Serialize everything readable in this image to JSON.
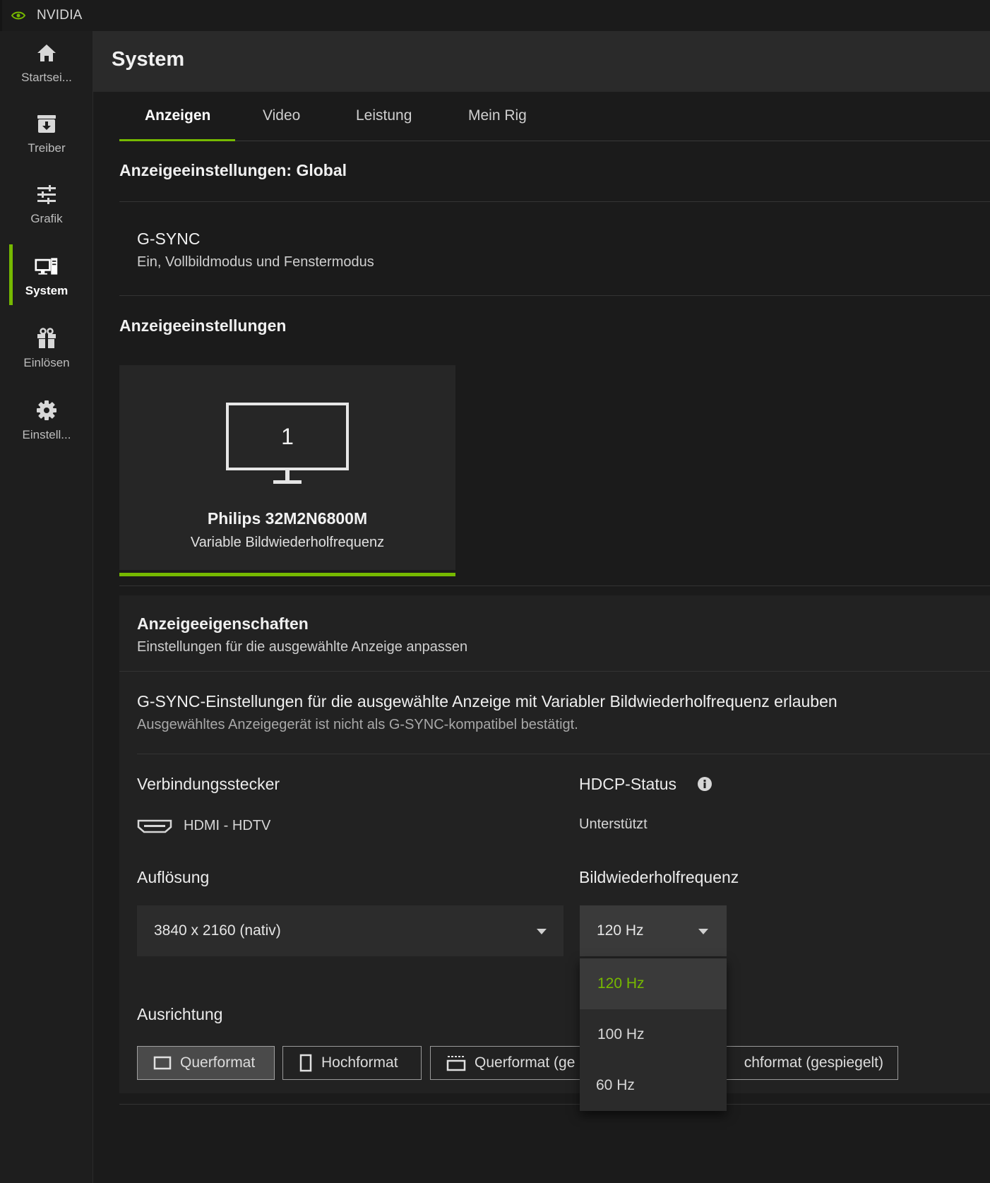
{
  "app": {
    "title": "NVIDIA",
    "accent": "#76b900"
  },
  "sidebar": {
    "items": [
      {
        "label": "Startsei...",
        "icon": "home-icon"
      },
      {
        "label": "Treiber",
        "icon": "driver-download-icon"
      },
      {
        "label": "Grafik",
        "icon": "sliders-icon"
      },
      {
        "label": "System",
        "icon": "system-monitor-icon",
        "active": true
      },
      {
        "label": "Einlösen",
        "icon": "gift-icon"
      },
      {
        "label": "Einstell...",
        "icon": "gear-icon"
      }
    ]
  },
  "header": {
    "title": "System"
  },
  "tabs": [
    {
      "label": "Anzeigen",
      "active": true
    },
    {
      "label": "Video"
    },
    {
      "label": "Leistung"
    },
    {
      "label": "Mein Rig"
    }
  ],
  "global": {
    "heading": "Anzeigeeinstellungen: Global",
    "gsync_title": "G-SYNC",
    "gsync_value": "Ein, Vollbildmodus und Fenstermodus"
  },
  "displays": {
    "heading": "Anzeigeeinstellungen",
    "card": {
      "number": "1",
      "name": "Philips 32M2N6800M",
      "mode": "Variable Bildwiederholfrequenz"
    }
  },
  "properties": {
    "title": "Anzeigeeigenschaften",
    "subtitle": "Einstellungen für die ausgewählte Anzeige anpassen",
    "allow_title": "G-SYNC-Einstellungen für die ausgewählte Anzeige mit Variabler Bildwiederholfrequenz erlauben",
    "allow_sub": "Ausgewähltes Anzeigegerät ist nicht als G-SYNC-kompatibel bestätigt.",
    "connector_label": "Verbindungsstecker",
    "connector_value": "HDMI - HDTV",
    "hdcp_label": "HDCP-Status",
    "hdcp_value": "Unterstützt",
    "resolution_label": "Auflösung",
    "resolution_value": "3840 x 2160 (nativ)",
    "refresh_label": "Bildwiederholfrequenz",
    "refresh_value": "120 Hz",
    "refresh_options": [
      "120 Hz",
      "100 Hz",
      "60 Hz"
    ],
    "orientation_label": "Ausrichtung",
    "orientation_options": [
      {
        "label": "Querformat",
        "active": true
      },
      {
        "label": "Hochformat"
      },
      {
        "label": "Querformat (ge"
      },
      {
        "label": "chformat (gespiegelt)"
      }
    ]
  }
}
